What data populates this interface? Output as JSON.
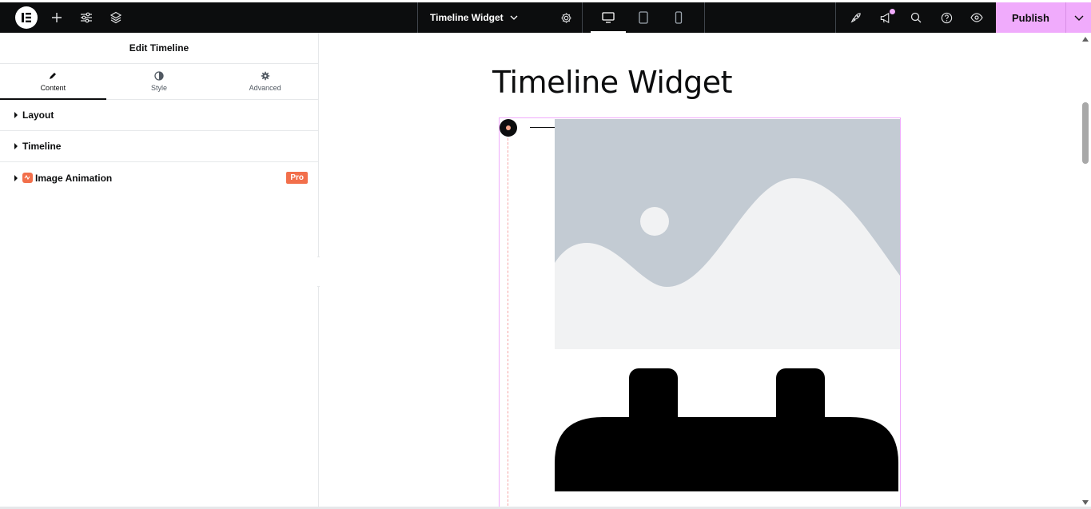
{
  "topbar": {
    "document_title": "Timeline Widget",
    "publish_label": "Publish",
    "left_icons": [
      "elementor-logo-icon",
      "plus-icon",
      "sliders-icon",
      "layers-icon"
    ],
    "device_modes": [
      "desktop-icon",
      "tablet-icon",
      "mobile-icon"
    ],
    "active_device": "desktop",
    "right_icons": [
      "rocket-icon",
      "megaphone-icon",
      "search-icon",
      "help-icon",
      "eye-icon"
    ],
    "accent_color": "#f0abfc"
  },
  "panel": {
    "title": "Edit Timeline",
    "tabs": [
      {
        "label": "Content",
        "icon": "pencil-icon"
      },
      {
        "label": "Style",
        "icon": "half-circle-icon"
      },
      {
        "label": "Advanced",
        "icon": "gear-icon"
      }
    ],
    "active_tab": "Content",
    "sections": [
      {
        "label": "Layout"
      },
      {
        "label": "Timeline"
      },
      {
        "label": "Image Animation",
        "badge": "Pro"
      }
    ]
  },
  "canvas": {
    "heading": "Timeline Widget"
  }
}
